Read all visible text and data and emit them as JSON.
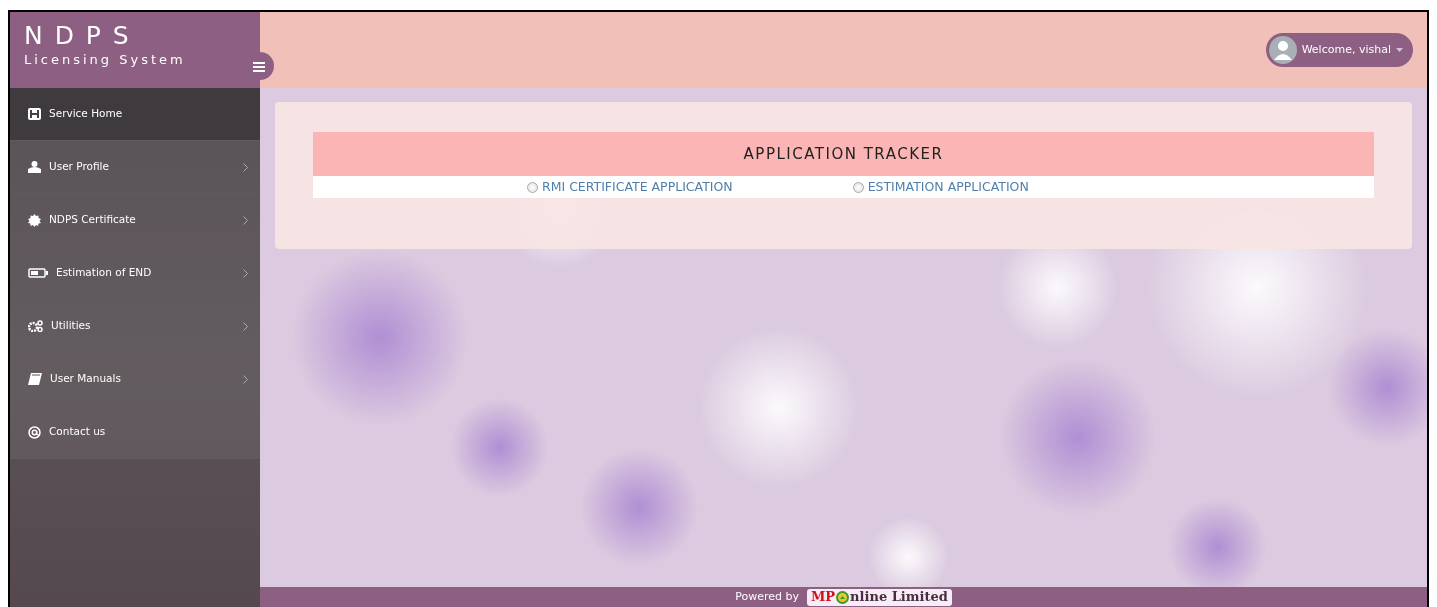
{
  "brand": {
    "title": "N D P S",
    "subtitle": "Licensing System"
  },
  "user_menu": {
    "label": "Welcome, vishal"
  },
  "sidebar": {
    "items": [
      {
        "label": "Service Home",
        "has_submenu": false,
        "selected": true
      },
      {
        "label": "User Profile",
        "has_submenu": true,
        "selected": false
      },
      {
        "label": "NDPS Certificate",
        "has_submenu": true,
        "selected": false
      },
      {
        "label": "Estimation of END",
        "has_submenu": true,
        "selected": false
      },
      {
        "label": "Utilities",
        "has_submenu": true,
        "selected": false
      },
      {
        "label": "User Manuals",
        "has_submenu": true,
        "selected": false
      },
      {
        "label": "Contact us",
        "has_submenu": false,
        "selected": false
      }
    ]
  },
  "tracker": {
    "title": "APPLICATION TRACKER",
    "options": [
      {
        "label": "RMI CERTIFICATE APPLICATION",
        "selected": false
      },
      {
        "label": "ESTIMATION APPLICATION",
        "selected": false
      }
    ]
  },
  "footer": {
    "powered_by": "Powered by",
    "logo_left": "MP",
    "logo_right": "nline Limited"
  }
}
